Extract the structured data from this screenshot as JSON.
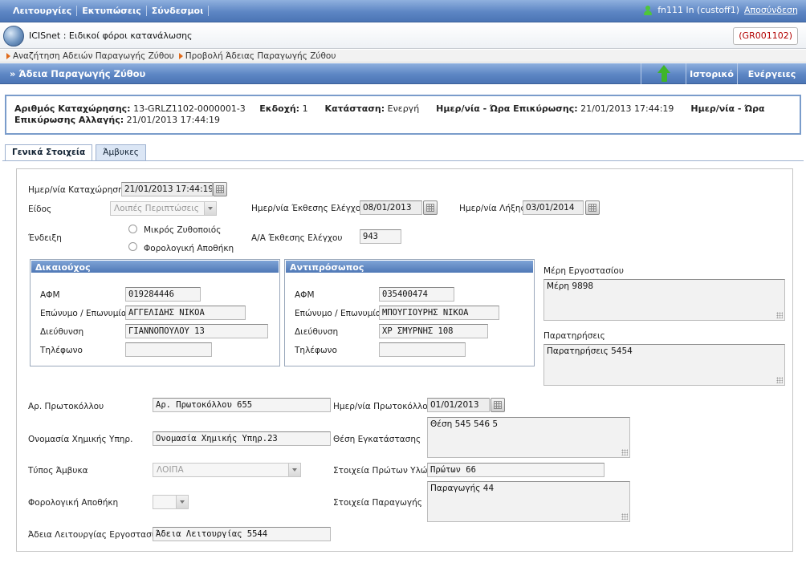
{
  "topmenu": {
    "items": [
      "Λειτουργίες",
      "Εκτυπώσεις",
      "Σύνδεσμοι"
    ]
  },
  "user": {
    "label": "fn111 ln (custoff1)",
    "logout": "Αποσύνδεση"
  },
  "app": {
    "title": "ICISnet : Ειδικοί φόροι κατανάλωσης",
    "code": "(GR001102)"
  },
  "breadcrumbs": [
    "Αναζήτηση Αδειών Παραγωγής Ζύθου",
    "Προβολή Άδειας Παραγωγής Ζύθου"
  ],
  "page": {
    "title": "» Άδεια Παραγωγής Ζύθου",
    "history": "Ιστορικό",
    "actions": "Ενέργειες"
  },
  "summary": {
    "reg_no_label": "Αριθμός Καταχώρησης:",
    "reg_no": "13-GRLZ1102-0000001-3",
    "version_label": "Εκδοχή:",
    "version": "1",
    "status_label": "Κατάσταση:",
    "status": "Ενεργή",
    "validation_label": "Ημερ/νία - Ώρα Επικύρωσης:",
    "validation": "21/01/2013 17:44:19",
    "change_validation_label": "Ημερ/νία - Ώρα Επικύρωσης Αλλαγής:",
    "change_validation": "21/01/2013 17:44:19"
  },
  "tabs": [
    "Γενικά Στοιχεία",
    "Άμβυκες"
  ],
  "form": {
    "reg_date_label": "Ημερ/νία Καταχώρησης",
    "reg_date": "21/01/2013 17:44:19",
    "kind_label": "Είδος",
    "kind": "Λοιπές Περιπτώσεις",
    "inspection_date_label": "Ημερ/νία Έκθεσης Ελέγχου",
    "inspection_date": "08/01/2013",
    "expiry_date_label": "Ημερ/νία Λήξης",
    "expiry_date": "03/01/2014",
    "indication_label": "Ένδειξη",
    "option_small": "Μικρός Ζυθοποιός",
    "option_warehouse": "Φορολογική Αποθήκη",
    "inspection_no_label": "Α/Α Έκθεσης Ελέγχου",
    "inspection_no": "943",
    "holder": {
      "title": "Δικαιούχος",
      "afm_label": "ΑΦΜ",
      "afm": "019284446",
      "name_label": "Επώνυμο / Επωνυμία",
      "name": "ΑΓΓΕΛΙΔΗΣ ΝΙΚΟΑ",
      "address_label": "Διεύθυνση",
      "address": "ΓΙΑΝΝΟΠΟΥΛΟΥ 13",
      "phone_label": "Τηλέφωνο",
      "phone": ""
    },
    "representative": {
      "title": "Αντιπρόσωπος",
      "afm_label": "ΑΦΜ",
      "afm": "035400474",
      "name_label": "Επώνυμο / Επωνυμία",
      "name": "ΜΠΟΥΓΙΟΥΡΗΣ ΝΙΚΟΑ",
      "address_label": "Διεύθυνση",
      "address": "ΧΡ ΣΜΥΡΝΗΣ 108",
      "phone_label": "Τηλέφωνο",
      "phone": ""
    },
    "factory_parts_label": "Μέρη Εργοστασίου",
    "factory_parts": "Μέρη 9898",
    "remarks_label": "Παρατηρήσεις",
    "remarks": "Παρατηρήσεις 5454",
    "protocol_no_label": "Αρ. Πρωτοκόλλου",
    "protocol_no": "Αρ. Πρωτοκόλλου 655",
    "protocol_date_label": "Ημερ/νία Πρωτοκόλλου",
    "protocol_date": "01/01/2013",
    "chemist_label": "Ονομασία Χημικής Υπηρ.",
    "chemist": "Ονομασία Χημικής Υπηρ.23",
    "install_pos_label": "Θέση Εγκατάστασης",
    "install_pos": "Θέση 545  546 5",
    "still_type_label": "Τύπος Άμβυκα",
    "still_type": "ΛΟΙΠΑ",
    "raw_materials_label": "Στοιχεία Πρώτων Υλών",
    "raw_materials": "Πρώτων 66",
    "tax_warehouse_label": "Φορολογική Αποθήκη",
    "tax_warehouse": "",
    "production_label": "Στοιχεία Παραγωγής",
    "production": "Παραγωγής 44",
    "factory_license_label": "Άδεια Λειτουργίας Εργοστασίου",
    "factory_license": "Άδεια Λειτουργίας 5544"
  }
}
